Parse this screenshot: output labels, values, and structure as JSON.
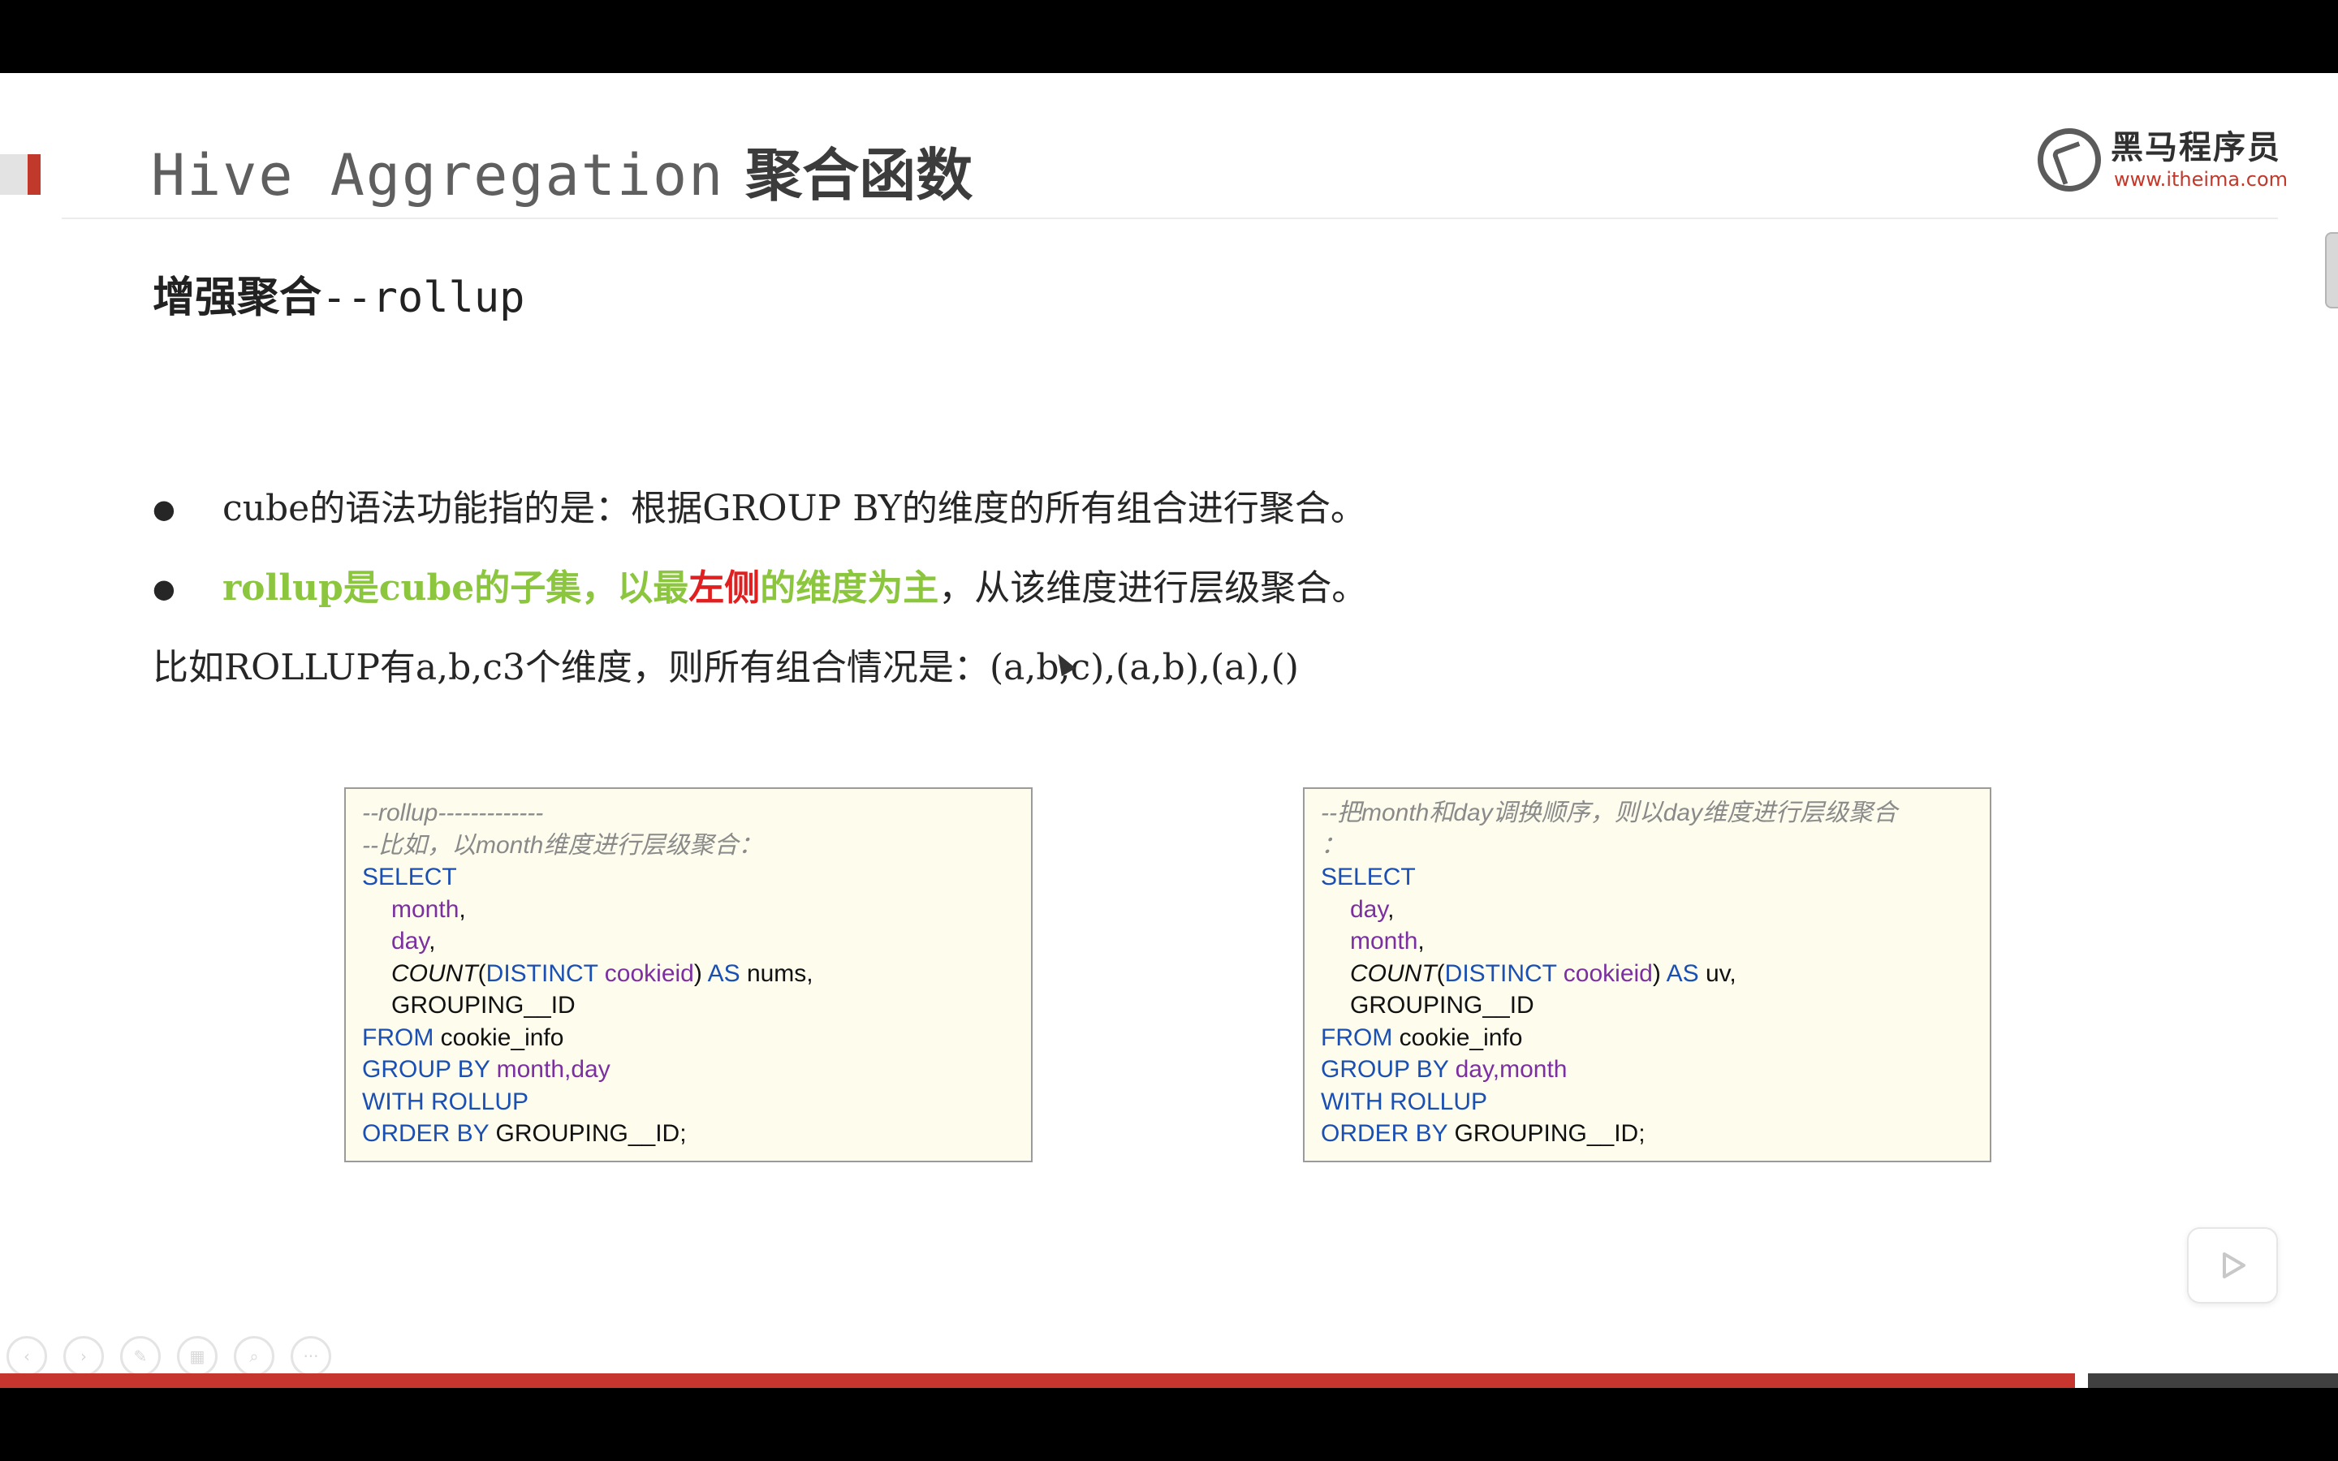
{
  "header": {
    "title_en": "Hive Aggregation",
    "title_zh": "聚合函数",
    "logo_name": "黑马程序员",
    "logo_url": "www.itheima.com"
  },
  "subtitle": {
    "zh": "增强聚合",
    "en": "--rollup"
  },
  "bullets": {
    "b1": {
      "p1": "cube",
      "p2": "的语法功能指的是：根据",
      "p3": "GROUP BY",
      "p4": "的维度的所有组合进行聚合。"
    },
    "b2": {
      "p1": "rollup",
      "p2": "是",
      "p3": "cube",
      "p4": "的子集，以最",
      "p5": "左侧",
      "p6": "的维度为主",
      "p7": "，从该维度进行层级聚合。"
    }
  },
  "example_line": {
    "p1": "比如",
    "p2": "ROLLUP",
    "p3": "有",
    "p4": "a,b,c3",
    "p5": "个维度，则所有组合情况是：",
    "p6": "(a,b,c),(a,b),(a),()"
  },
  "code_left": {
    "c1": "--rollup-------------",
    "c2": "--比如，以month维度进行层级聚合：",
    "select": "SELECT",
    "month": "month",
    "comma": ",",
    "day": "day",
    "count": "COUNT",
    "paren_open": "(",
    "distinct": "DISTINCT",
    "cookieid": "cookieid",
    "paren_close": ")",
    "as": "AS",
    "alias": "nums,",
    "grouping_id": "GROUPING__ID",
    "from": "FROM",
    "table": "cookie_info",
    "group_by": "GROUP BY",
    "group_cols": "month,day",
    "with_rollup": "WITH ROLLUP",
    "order_by": "ORDER BY",
    "order_col": "GROUPING__ID;"
  },
  "code_right": {
    "c1": "--把month和day调换顺序，则以day维度进行层级聚合",
    "c2": "：",
    "select": "SELECT",
    "day": "day",
    "comma": ",",
    "month": "month",
    "count": "COUNT",
    "paren_open": "(",
    "distinct": "DISTINCT",
    "cookieid": "cookieid",
    "paren_close": ")",
    "as": "AS",
    "alias": "uv,",
    "grouping_id": "GROUPING__ID",
    "from": "FROM",
    "table": "cookie_info",
    "group_by": "GROUP BY",
    "group_cols": "day,month",
    "with_rollup": "WITH ROLLUP",
    "order_by": "ORDER BY",
    "order_col": "GROUPING__ID;"
  },
  "colors": {
    "accent_red": "#c6352e",
    "highlight_green": "#8cc63f",
    "highlight_red": "#e02020",
    "code_keyword": "#1a4fb3",
    "code_identifier": "#7b2fa1",
    "code_bg": "#fefcec"
  },
  "nav_icons": [
    "prev-icon",
    "next-icon",
    "pen-icon",
    "slides-icon",
    "zoom-icon",
    "more-icon"
  ]
}
